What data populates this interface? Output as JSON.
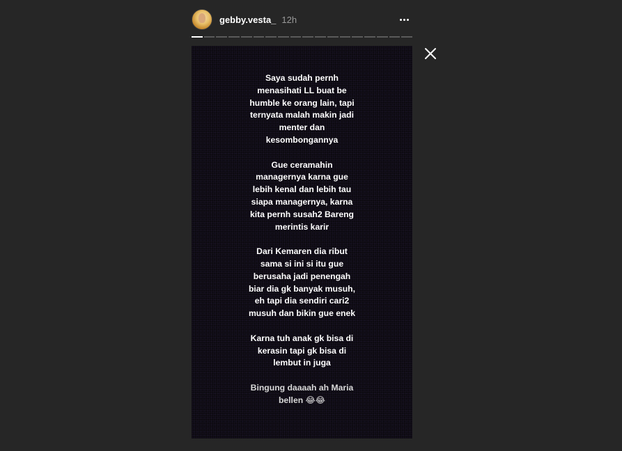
{
  "header": {
    "username": "gebby.vesta_",
    "time": "12h"
  },
  "progress": {
    "segments": 18,
    "active_index": 0
  },
  "story": {
    "paragraphs": [
      [
        "Saya sudah pernh",
        "menasihati LL buat be",
        "humble ke orang lain, tapi",
        "ternyata malah makin jadi",
        "menter dan",
        "kesombongannya"
      ],
      [
        "Gue ceramahin",
        "managernya karna gue",
        "lebih kenal dan lebih tau",
        "siapa managernya, karna",
        "kita pernh susah2 Bareng",
        "merintis karir"
      ],
      [
        "Dari Kemaren dia ribut",
        "sama si ini si itu gue",
        "berusaha jadi penengah",
        "biar dia gk banyak musuh,",
        "eh tapi dia sendiri cari2",
        "musuh dan bikin gue enek"
      ],
      [
        "Karna tuh anak gk bisa di",
        "kerasin tapi gk bisa di",
        "lembut in juga"
      ],
      [
        "Bingung daaaah ah Maria",
        "bellen 😂😂"
      ]
    ]
  },
  "icons": {
    "more": "more-options-icon",
    "close": "close-icon"
  }
}
